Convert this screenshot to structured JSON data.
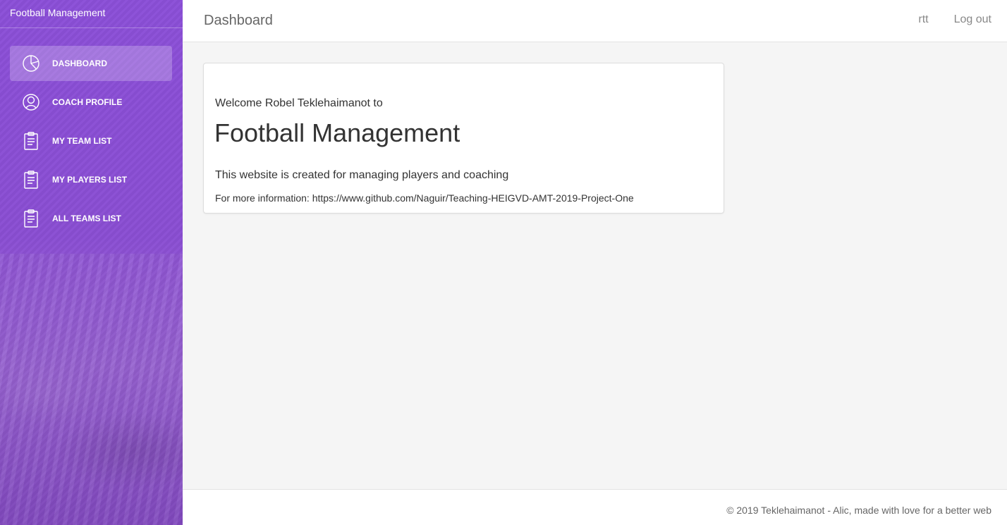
{
  "sidebar": {
    "brand": "Football Management",
    "items": [
      {
        "label": "DASHBOARD",
        "icon": "pie-chart-icon",
        "active": true
      },
      {
        "label": "COACH PROFILE",
        "icon": "user-icon",
        "active": false
      },
      {
        "label": "MY TEAM LIST",
        "icon": "clipboard-icon",
        "active": false
      },
      {
        "label": "MY PLAYERS LIST",
        "icon": "clipboard-icon",
        "active": false
      },
      {
        "label": "ALL TEAMS LIST",
        "icon": "clipboard-icon",
        "active": false
      }
    ]
  },
  "header": {
    "title": "Dashboard",
    "user_link": "rtt",
    "logout_link": "Log out"
  },
  "main": {
    "welcome": "Welcome Robel Teklehaimanot to",
    "headline": "Football Management",
    "description": "This website is created for managing players and coaching",
    "info": "For more information: https://www.github.com/Naguir/Teaching-HEIGVD-AMT-2019-Project-One"
  },
  "footer": {
    "copyright": "© 2019 Teklehaimanot - Alic, made with love for a better web"
  },
  "colors": {
    "sidebar": "#8b4fd8",
    "accent": "#9c27b0"
  }
}
